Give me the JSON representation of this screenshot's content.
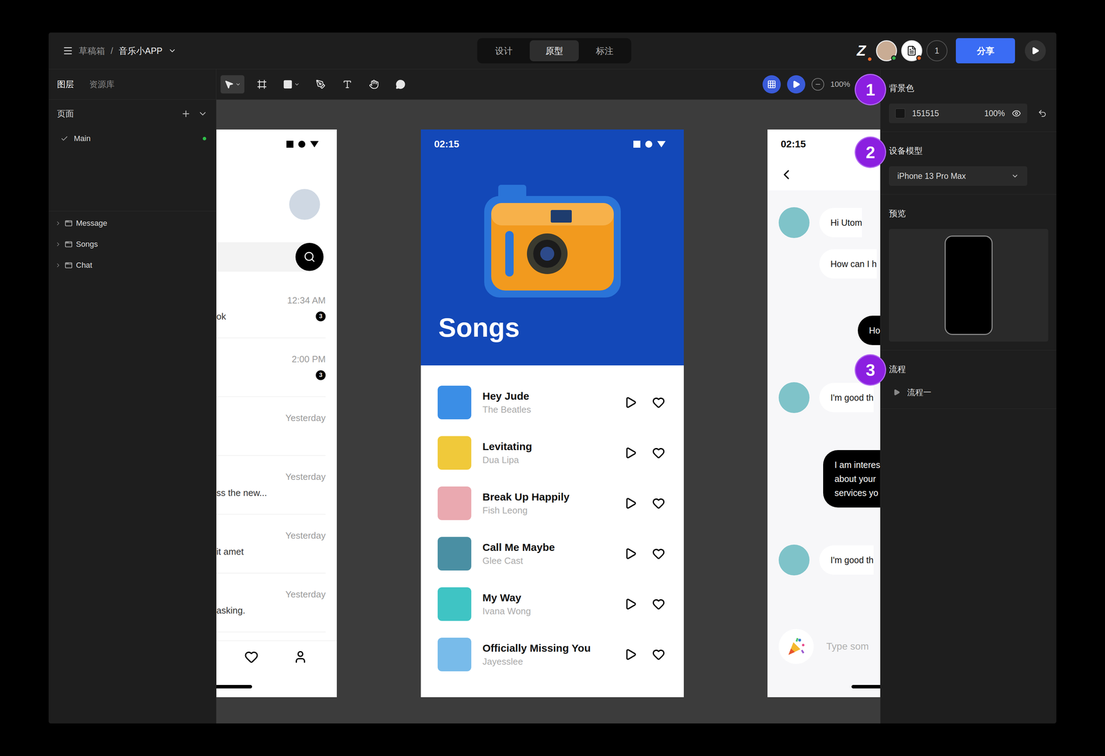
{
  "topbar": {
    "breadcrumb": {
      "folder": "草稿箱",
      "separator": "/",
      "file": "音乐小APP"
    },
    "modes": [
      {
        "label": "设计",
        "selected": false
      },
      {
        "label": "原型",
        "selected": true
      },
      {
        "label": "标注",
        "selected": false
      }
    ],
    "collaborators": [
      {
        "kind": "logo",
        "mark": "Z",
        "color": "#f26b2a"
      },
      {
        "kind": "avatar",
        "mark": "",
        "color": "#35b34a"
      },
      {
        "kind": "document",
        "mark": "",
        "color": "#f26b2a"
      }
    ],
    "online_count": "1",
    "share_button": "分享"
  },
  "left_panel": {
    "tabs": [
      {
        "label": "图层",
        "selected": true
      },
      {
        "label": "资源库",
        "selected": false
      }
    ],
    "pages_title": "页面",
    "pages": [
      {
        "name": "Main",
        "selected": true
      }
    ],
    "layers": [
      {
        "name": "Message",
        "expanded": false
      },
      {
        "name": "Songs",
        "expanded": false
      },
      {
        "name": "Chat",
        "expanded": false
      }
    ]
  },
  "toolbar": {
    "tools": [
      {
        "kind": "move",
        "selected": true,
        "has_menu": true
      },
      {
        "kind": "frame",
        "selected": false,
        "has_menu": false
      },
      {
        "kind": "rectangle",
        "selected": false,
        "has_menu": true
      },
      {
        "kind": "pen",
        "selected": false,
        "has_menu": false
      },
      {
        "kind": "text",
        "selected": false,
        "has_menu": false
      },
      {
        "kind": "hand",
        "selected": false,
        "has_menu": false
      },
      {
        "kind": "comment",
        "selected": false,
        "has_menu": false
      }
    ],
    "zoom": "100%"
  },
  "right_panel": {
    "background": {
      "label": "背景色",
      "hex": "151515",
      "opacity": "100%",
      "visible": true
    },
    "device": {
      "label": "设备模型",
      "value": "iPhone 13 Pro Max"
    },
    "preview": {
      "label": "预览"
    },
    "flows": {
      "label": "流程",
      "items": [
        {
          "name": "流程一"
        }
      ]
    }
  },
  "annotations": [
    "1",
    "2",
    "3"
  ],
  "canvas": {
    "message_frame": {
      "rows": [
        {
          "preview": "ok",
          "time": "12:34 AM",
          "unread": "3"
        },
        {
          "preview": "",
          "time": "2:00 PM",
          "unread": "3"
        },
        {
          "preview": "",
          "time": "Yesterday",
          "unread": ""
        },
        {
          "preview": "ss the new...",
          "time": "Yesterday",
          "unread": ""
        },
        {
          "preview": "it amet",
          "time": "Yesterday",
          "unread": ""
        },
        {
          "preview": "asking.",
          "time": "Yesterday",
          "unread": ""
        }
      ]
    },
    "songs_frame": {
      "time": "02:15",
      "title": "Songs",
      "songs": [
        {
          "title": "Hey Jude",
          "artist": "The Beatles",
          "liked": false,
          "color": "#3b8ee6"
        },
        {
          "title": "Levitating",
          "artist": "Dua Lipa",
          "liked": false,
          "color": "#f0c93a"
        },
        {
          "title": "Break Up Happily",
          "artist": "Fish Leong",
          "liked": false,
          "color": "#eaa9b0"
        },
        {
          "title": "Call Me Maybe",
          "artist": "Glee Cast",
          "liked": false,
          "color": "#4a8fa3"
        },
        {
          "title": "My Way",
          "artist": "Ivana Wong",
          "liked": false,
          "color": "#3fc4c4"
        },
        {
          "title": "Officially Missing You",
          "artist": "Jayesslee",
          "liked": false,
          "color": "#78bbea"
        }
      ]
    },
    "chat_frame": {
      "time": "02:15",
      "messages": [
        {
          "kind": "received",
          "show_avatar": true,
          "lines": [
            "Hi Utom"
          ]
        },
        {
          "kind": "received",
          "show_avatar": false,
          "lines": [
            "How can I h"
          ]
        },
        {
          "kind": "sent",
          "show_avatar": false,
          "lines": [
            "Ho"
          ]
        },
        {
          "kind": "received",
          "show_avatar": true,
          "lines": [
            "I'm good th"
          ]
        },
        {
          "kind": "sent",
          "show_avatar": false,
          "lines": [
            "I am interes",
            "about your",
            "services yo"
          ]
        },
        {
          "kind": "received",
          "show_avatar": true,
          "lines": [
            "I'm good th"
          ]
        }
      ],
      "input_placeholder": "Type som"
    }
  }
}
